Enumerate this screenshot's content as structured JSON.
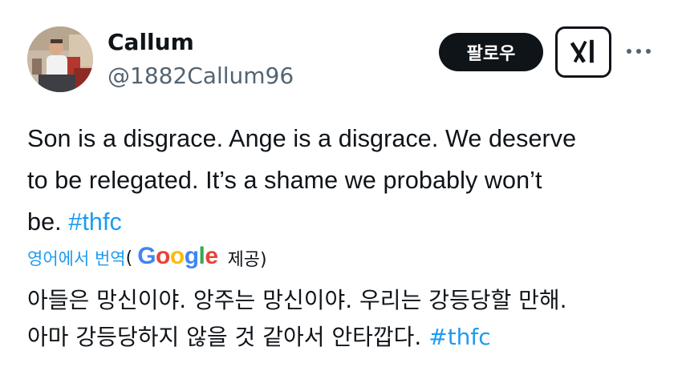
{
  "author": {
    "display_name": "Callum",
    "handle": "@1882Callum96"
  },
  "actions": {
    "follow_label": "팔로우",
    "grok_icon": "grok-icon",
    "more_icon": "more-icon"
  },
  "tweet": {
    "lines": [
      "Son is a disgrace. Ange is a disgrace. We deserve",
      "to be relegated. It’s a shame we probably won’t",
      "be."
    ],
    "hashtag": "#thfc"
  },
  "translation": {
    "link_label": "영어에서 번역",
    "open_paren": "(",
    "provider_logo": "Google",
    "provided_label": "제공)",
    "lines": [
      "아들은 망신이야. 앙주는 망신이야. 우리는 강등당할 만해.",
      "아마 강등당하지 않을 것 같아서 안타깝다."
    ],
    "hashtag": "#thfc"
  },
  "colors": {
    "link": "#1d9bf0",
    "text": "#0f1419",
    "secondary": "#536471",
    "button_bg": "#0f1419"
  }
}
